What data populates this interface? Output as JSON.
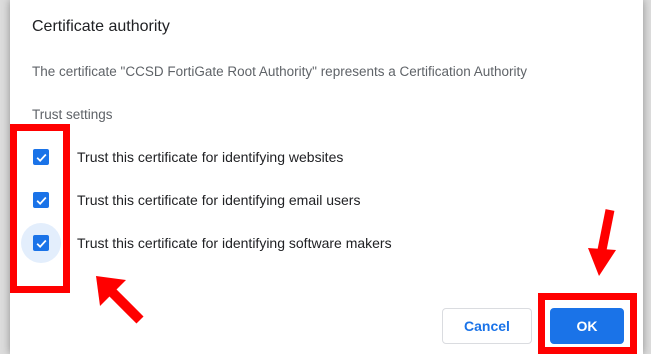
{
  "dialog": {
    "title": "Certificate authority",
    "description": "The certificate \"CCSD FortiGate Root Authority\" represents a Certification Authority",
    "section_label": "Trust settings",
    "trust_options": [
      {
        "label": "Trust this certificate for identifying websites",
        "checked": true
      },
      {
        "label": "Trust this certificate for identifying email users",
        "checked": true
      },
      {
        "label": "Trust this certificate for identifying software makers",
        "checked": true,
        "focused": true
      }
    ],
    "buttons": {
      "cancel": "Cancel",
      "ok": "OK"
    }
  },
  "colors": {
    "accent": "#1a73e8",
    "annotation": "#ff0000"
  },
  "icons": {
    "checkbox": "check-icon",
    "annotation": "arrow-icon"
  }
}
